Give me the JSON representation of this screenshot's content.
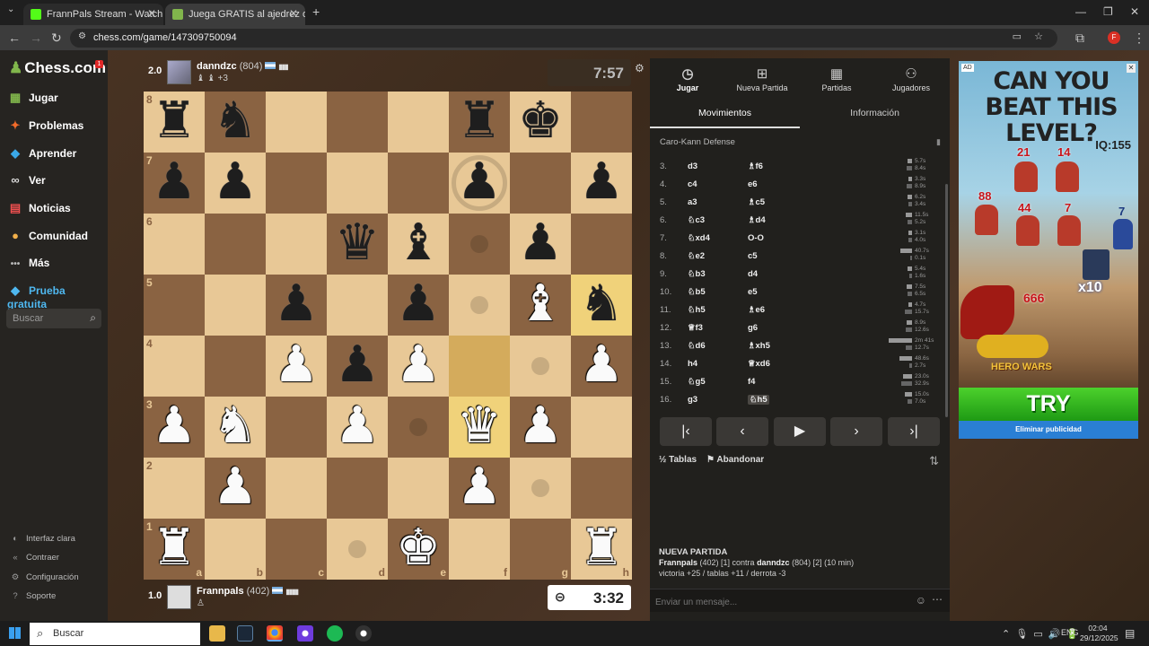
{
  "browser": {
    "tabs": [
      {
        "title": "FrannPals Stream - Watch Live",
        "favicon_color": "#53fc18"
      },
      {
        "title": "Juega GRATIS al ajedrez online",
        "favicon_color": "#81b64c"
      }
    ],
    "new_tab": "+",
    "url": "chess.com/game/147309750094"
  },
  "sidebar": {
    "logo": "Chess.com",
    "badge": "1",
    "items": [
      {
        "label": "Jugar",
        "icon": "board-icon",
        "glyph": "▦",
        "color": "#81b64c"
      },
      {
        "label": "Problemas",
        "icon": "puzzle-icon",
        "glyph": "✦",
        "color": "#f26b2a"
      },
      {
        "label": "Aprender",
        "icon": "learn-icon",
        "glyph": "◆",
        "color": "#3aa8e8"
      },
      {
        "label": "Ver",
        "icon": "binoculars-icon",
        "glyph": "∞",
        "color": "#ddd"
      },
      {
        "label": "Noticias",
        "icon": "news-icon",
        "glyph": "▤",
        "color": "#f05050"
      },
      {
        "label": "Comunidad",
        "icon": "community-icon",
        "glyph": "●",
        "color": "#f2b04a"
      },
      {
        "label": "Más",
        "icon": "more-icon",
        "glyph": "•••",
        "color": "#bbb"
      }
    ],
    "trial": {
      "label": "Prueba gratuita",
      "icon": "diamond-icon",
      "glyph": "◆"
    },
    "search_placeholder": "Buscar",
    "bottom": [
      {
        "label": "Interfaz clara",
        "icon": "theme-icon",
        "glyph": "◐"
      },
      {
        "label": "Contraer",
        "icon": "collapse-icon",
        "glyph": "«"
      },
      {
        "label": "Configuración",
        "icon": "gear-icon",
        "glyph": "⚙"
      },
      {
        "label": "Soporte",
        "icon": "help-icon",
        "glyph": "?"
      }
    ]
  },
  "top_player": {
    "score": "2.0",
    "name": "danndzc",
    "rating": "(804)",
    "bars": "▮▮▮",
    "captured": "♝ ♝ +3",
    "clock": "7:57"
  },
  "bottom_player": {
    "score": "1.0",
    "name": "Frannpals",
    "rating": "(402)",
    "bars": "▮▮▮▮",
    "captured": "♙",
    "clock": "3:32"
  },
  "board": {
    "ranks": [
      "8",
      "7",
      "6",
      "5",
      "4",
      "3",
      "2",
      "1"
    ],
    "files": [
      "a",
      "b",
      "c",
      "d",
      "e",
      "f",
      "g",
      "h"
    ],
    "position": [
      [
        "br",
        "bn",
        "",
        "",
        "",
        "br",
        "bk",
        ""
      ],
      [
        "bp",
        "bp",
        "",
        "",
        "",
        "bp",
        "",
        "bp"
      ],
      [
        "",
        "",
        "",
        "bq",
        "bb",
        "",
        "bp",
        ""
      ],
      [
        "",
        "",
        "bp",
        "",
        "bp",
        "",
        "wb",
        "bn"
      ],
      [
        "",
        "",
        "wp",
        "bp",
        "wp",
        "",
        "",
        "wp"
      ],
      [
        "wp",
        "wn",
        "",
        "wp",
        "",
        "wq",
        "wp",
        ""
      ],
      [
        "",
        "wp",
        "",
        "",
        "",
        "wp",
        "",
        ""
      ],
      [
        "wr",
        "",
        "",
        "",
        "wk",
        "",
        "",
        "wr"
      ]
    ],
    "highlights": [
      "f3",
      "f4",
      "h5"
    ],
    "move_dots": [
      "d1",
      "e3",
      "f5",
      "f6",
      "g2",
      "g4"
    ],
    "capture_rings": [
      "f7"
    ]
  },
  "panel": {
    "tabs": [
      {
        "label": "Jugar",
        "icon": "clock-icon",
        "glyph": "◷"
      },
      {
        "label": "Nueva Partida",
        "icon": "plus-icon",
        "glyph": "⊞"
      },
      {
        "label": "Partidas",
        "icon": "games-icon",
        "glyph": "▦"
      },
      {
        "label": "Jugadores",
        "icon": "players-icon",
        "glyph": "👥"
      }
    ],
    "subtabs": [
      "Movimientos",
      "Información"
    ],
    "opening": "Caro-Kann Defense",
    "moves": [
      {
        "num": "3.",
        "white": "d3",
        "black": "♗f6",
        "wt": "5.7s",
        "bt": "8.4s",
        "wv": 5.7,
        "bv": 8.4
      },
      {
        "num": "4.",
        "white": "c4",
        "black": "e6",
        "wt": "3.3s",
        "bt": "8.9s",
        "wv": 3.3,
        "bv": 8.9
      },
      {
        "num": "5.",
        "white": "a3",
        "black": "♗c5",
        "wt": "6.2s",
        "bt": "3.4s",
        "wv": 6.2,
        "bv": 3.4
      },
      {
        "num": "6.",
        "white": "♘c3",
        "black": "♗d4",
        "wt": "11.5s",
        "bt": "5.2s",
        "wv": 11.5,
        "bv": 5.2
      },
      {
        "num": "7.",
        "white": "♘xd4",
        "black": "O-O",
        "wt": "3.1s",
        "bt": "4.0s",
        "wv": 3.1,
        "bv": 4.0
      },
      {
        "num": "8.",
        "white": "♘e2",
        "black": "c5",
        "wt": "40.7s",
        "bt": "0.1s",
        "wv": 40.7,
        "bv": 0.1
      },
      {
        "num": "9.",
        "white": "♘b3",
        "black": "d4",
        "wt": "5.4s",
        "bt": "1.6s",
        "wv": 5.4,
        "bv": 1.6
      },
      {
        "num": "10.",
        "white": "♘b5",
        "black": "e5",
        "wt": "7.5s",
        "bt": "6.5s",
        "wv": 7.5,
        "bv": 6.5
      },
      {
        "num": "11.",
        "white": "♘h5",
        "black": "♗e6",
        "wt": "4.7s",
        "bt": "15.7s",
        "wv": 4.7,
        "bv": 15.7
      },
      {
        "num": "12.",
        "white": "♕f3",
        "black": "g6",
        "wt": "8.9s",
        "bt": "12.6s",
        "wv": 8.9,
        "bv": 12.6
      },
      {
        "num": "13.",
        "white": "♘d6",
        "black": "♗xh5",
        "wt": "2m 41s",
        "bt": "12.7s",
        "wv": 161,
        "bv": 12.7
      },
      {
        "num": "14.",
        "white": "h4",
        "black": "♕xd6",
        "wt": "48.6s",
        "bt": "2.7s",
        "wv": 48.6,
        "bv": 2.7
      },
      {
        "num": "15.",
        "white": "♘g5",
        "black": "f4",
        "wt": "23.0s",
        "bt": "32.9s",
        "wv": 23.0,
        "bv": 32.9
      },
      {
        "num": "16.",
        "white": "g3",
        "black": "♘h5",
        "wt": "15.0s",
        "bt": "7.0s",
        "wv": 15.0,
        "bv": 7.0
      }
    ],
    "controls": [
      {
        "glyph": "⏮",
        "name": "first-move-button"
      },
      {
        "glyph": "‹",
        "name": "prev-move-button"
      },
      {
        "glyph": "▶",
        "name": "play-button"
      },
      {
        "glyph": "›",
        "name": "next-move-button"
      },
      {
        "glyph": "⏭",
        "name": "last-move-button"
      }
    ],
    "draw": "Tablas",
    "draw_glyph": "½",
    "resign": "Abandonar",
    "resign_glyph": "⚑",
    "new_game_title": "NUEVA PARTIDA",
    "new_game_p1": "Frannpals",
    "new_game_rest": " (402) [1] contra ",
    "new_game_p2": "danndzc",
    "new_game_tail": " (804) [2] (10 min)",
    "new_game_line2": "victoria +25 / tablas +11 / derrota -3",
    "chat_placeholder": "Enviar un mensaje..."
  },
  "ad": {
    "badge": "AD",
    "headline": "CAN YOU BEAT THIS LEVEL?",
    "iq": "IQ:155",
    "numbers": [
      "21",
      "14",
      "88",
      "44",
      "7"
    ],
    "hero_number": "7",
    "x10": "x10",
    "power": "666",
    "brand": "HERO WARS",
    "cta": "TRY",
    "remove": "Eliminar publicidad"
  },
  "taskbar": {
    "search": "Buscar",
    "lang": "ENG",
    "time": "02:04",
    "date": "29/12/2025"
  },
  "colors": {
    "light_square": "#e8c896",
    "dark_square": "#8a6342",
    "accent": "#81b64c"
  }
}
